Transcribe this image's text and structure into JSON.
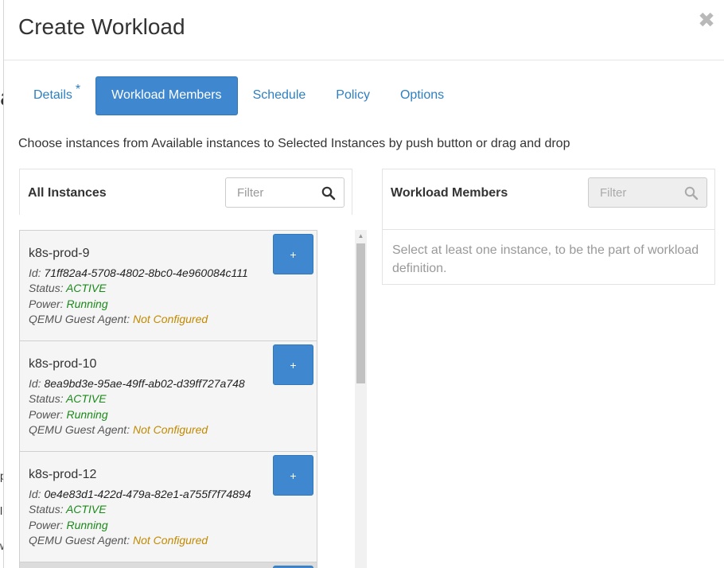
{
  "modal": {
    "title": "Create Workload",
    "close_symbol": "✖"
  },
  "background_fragments": [
    "a",
    "p",
    "l",
    "w"
  ],
  "tabs": [
    {
      "label": "Details",
      "required": "*"
    },
    {
      "label": "Workload Members"
    },
    {
      "label": "Schedule"
    },
    {
      "label": "Policy"
    },
    {
      "label": "Options"
    }
  ],
  "instructions": "Choose instances from Available instances to Selected Instances by push button or drag and drop",
  "all_instances": {
    "title": "All Instances",
    "filter_placeholder": "Filter"
  },
  "workload_members": {
    "title": "Workload Members",
    "filter_placeholder": "Filter",
    "empty_message": "Select at least one instance, to be the part of workload definition."
  },
  "labels": {
    "id": "Id:",
    "status": "Status:",
    "power": "Power:",
    "agent": "QEMU Guest Agent:",
    "add": "+"
  },
  "instances": [
    {
      "name": "k8s-prod-9",
      "id": "71ff82a4-5708-4802-8bc0-4e960084c111",
      "status": "ACTIVE",
      "power": "Running",
      "agent": "Not Configured"
    },
    {
      "name": "k8s-prod-10",
      "id": "8ea9bd3e-95ae-49ff-ab02-d39ff727a748",
      "status": "ACTIVE",
      "power": "Running",
      "agent": "Not Configured"
    },
    {
      "name": "k8s-prod-12",
      "id": "0e4e83d1-422d-479a-82e1-a755f7f74894",
      "status": "ACTIVE",
      "power": "Running",
      "agent": "Not Configured"
    }
  ],
  "colors": {
    "primary": "#3f88cf",
    "link": "#2e7fc1",
    "ok": "#1a8a1a",
    "warn": "#c18a00"
  }
}
